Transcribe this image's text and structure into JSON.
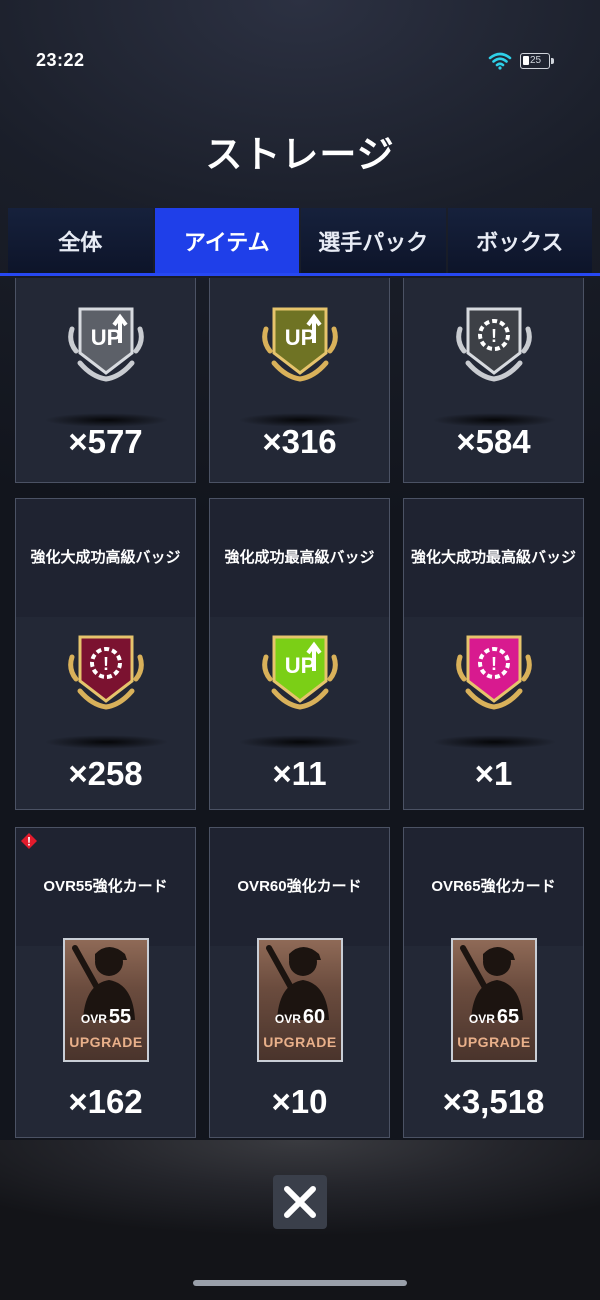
{
  "status": {
    "time": "23:22",
    "battery": "25"
  },
  "title": "ストレージ",
  "tabs": [
    {
      "label": "全体"
    },
    {
      "label": "アイテム"
    },
    {
      "label": "選手パック"
    },
    {
      "label": "ボックス"
    }
  ],
  "active_tab": "アイテム",
  "items": [
    {
      "name": "",
      "count": "×577",
      "icon": "up-badge-silver-icon"
    },
    {
      "name": "",
      "count": "×316",
      "icon": "up-badge-gold-icon"
    },
    {
      "name": "",
      "count": "×584",
      "icon": "gear-badge-silver-icon"
    },
    {
      "name": "強化大成功高級バッジ",
      "count": "×258",
      "icon": "gear-badge-crimson-icon"
    },
    {
      "name": "強化成功最高級バッジ",
      "count": "×11",
      "icon": "up-badge-lime-icon"
    },
    {
      "name": "強化大成功最高級バッジ",
      "count": "×1",
      "icon": "gear-badge-magenta-icon"
    },
    {
      "name": "OVR55強化カード",
      "count": "×162",
      "icon": "upgrade-card-icon",
      "ovr_label": "OVR",
      "ovr_value": "55",
      "upgrade_label": "UPGRADE",
      "alert": true
    },
    {
      "name": "OVR60強化カード",
      "count": "×10",
      "icon": "upgrade-card-icon",
      "ovr_label": "OVR",
      "ovr_value": "60",
      "upgrade_label": "UPGRADE"
    },
    {
      "name": "OVR65強化カード",
      "count": "×3,518",
      "icon": "upgrade-card-icon",
      "ovr_label": "OVR",
      "ovr_value": "65",
      "upgrade_label": "UPGRADE"
    }
  ],
  "colors": {
    "accent_tab": "#1f3fe9",
    "silver": "#8e939c",
    "gold": "#8a8f2c",
    "crimson": "#7b1230",
    "lime": "#7bcf16",
    "magenta": "#d81a8f"
  }
}
